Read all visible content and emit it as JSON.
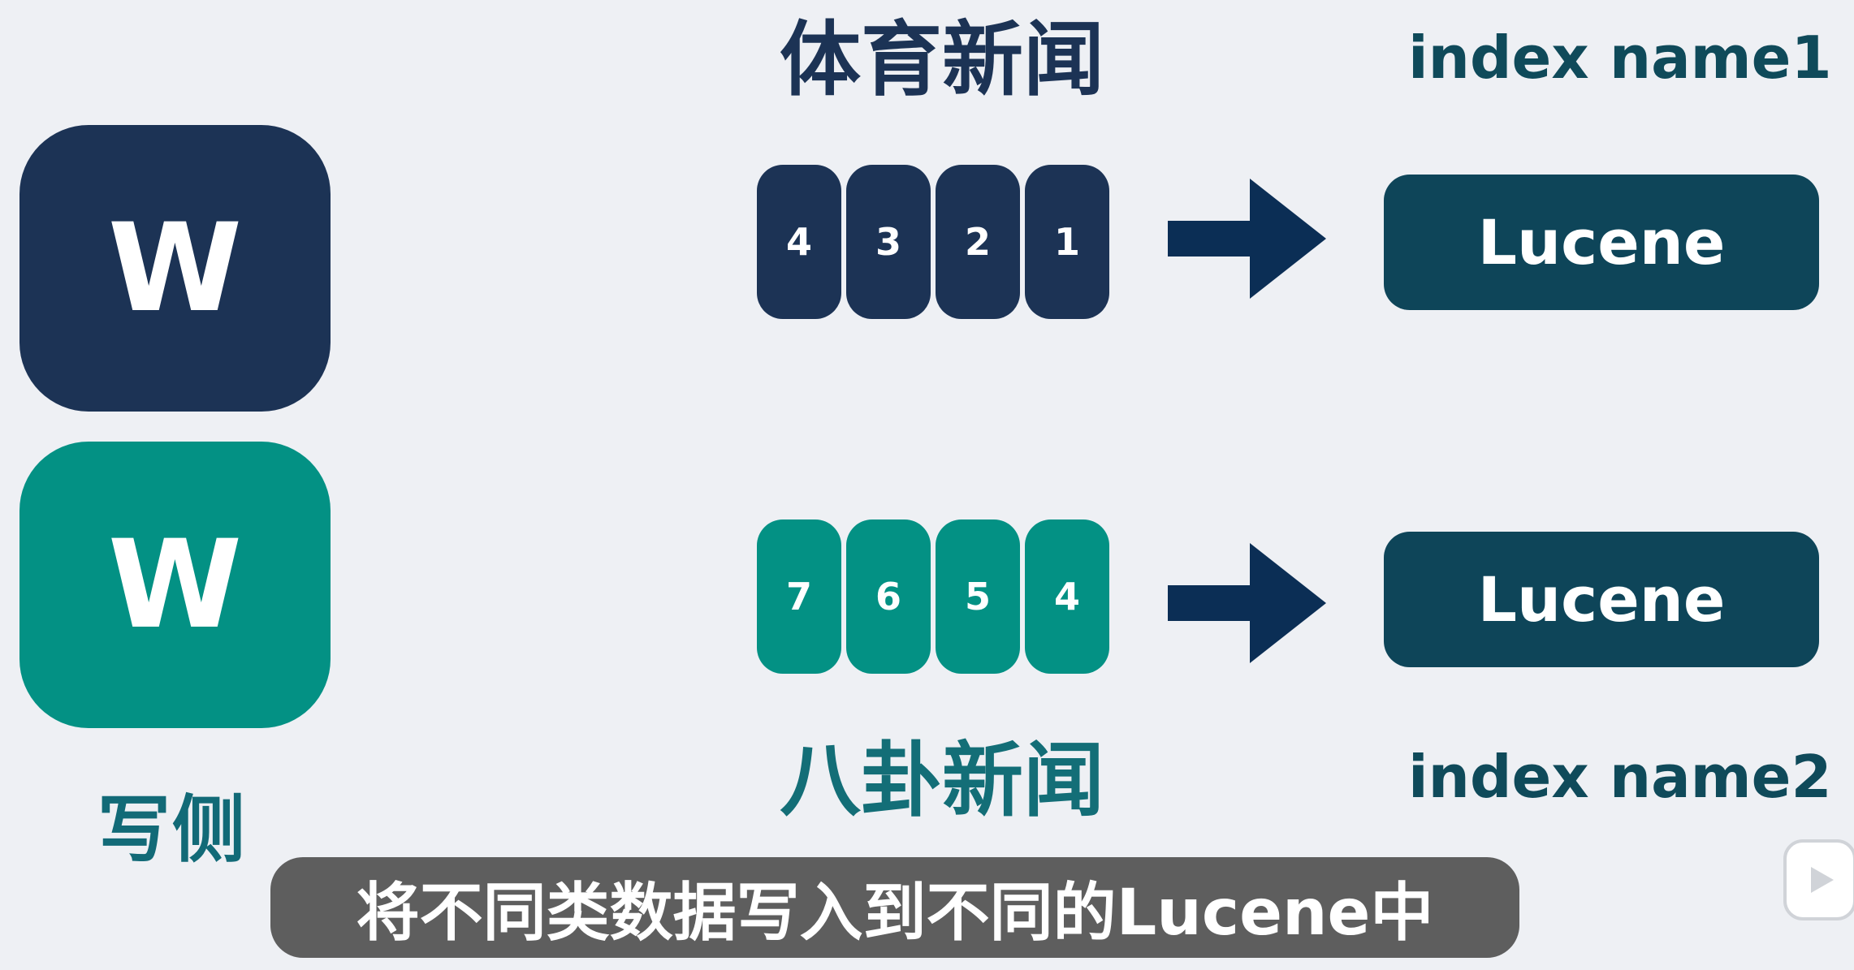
{
  "writers": [
    {
      "label": "W",
      "color": "#1c3355"
    },
    {
      "label": "W",
      "color": "#039184"
    }
  ],
  "side_label": "写侧",
  "categories": [
    {
      "title": "体育新闻",
      "index_name": "index name1",
      "docs": [
        "4",
        "3",
        "2",
        "1"
      ],
      "color": "#1c3355",
      "engine": "Lucene"
    },
    {
      "title": "八卦新闻",
      "index_name": "index name2",
      "docs": [
        "7",
        "6",
        "5",
        "4"
      ],
      "color": "#039184",
      "engine": "Lucene"
    }
  ],
  "subtitle": "将不同类数据写入到不同的Lucene中",
  "colors": {
    "background": "#eef0f4",
    "arrow": "#0b2e55",
    "lucene_box": "#0e4559",
    "subtitle_bar": "#5e5e5e"
  },
  "icons": {
    "player": "play-icon"
  }
}
